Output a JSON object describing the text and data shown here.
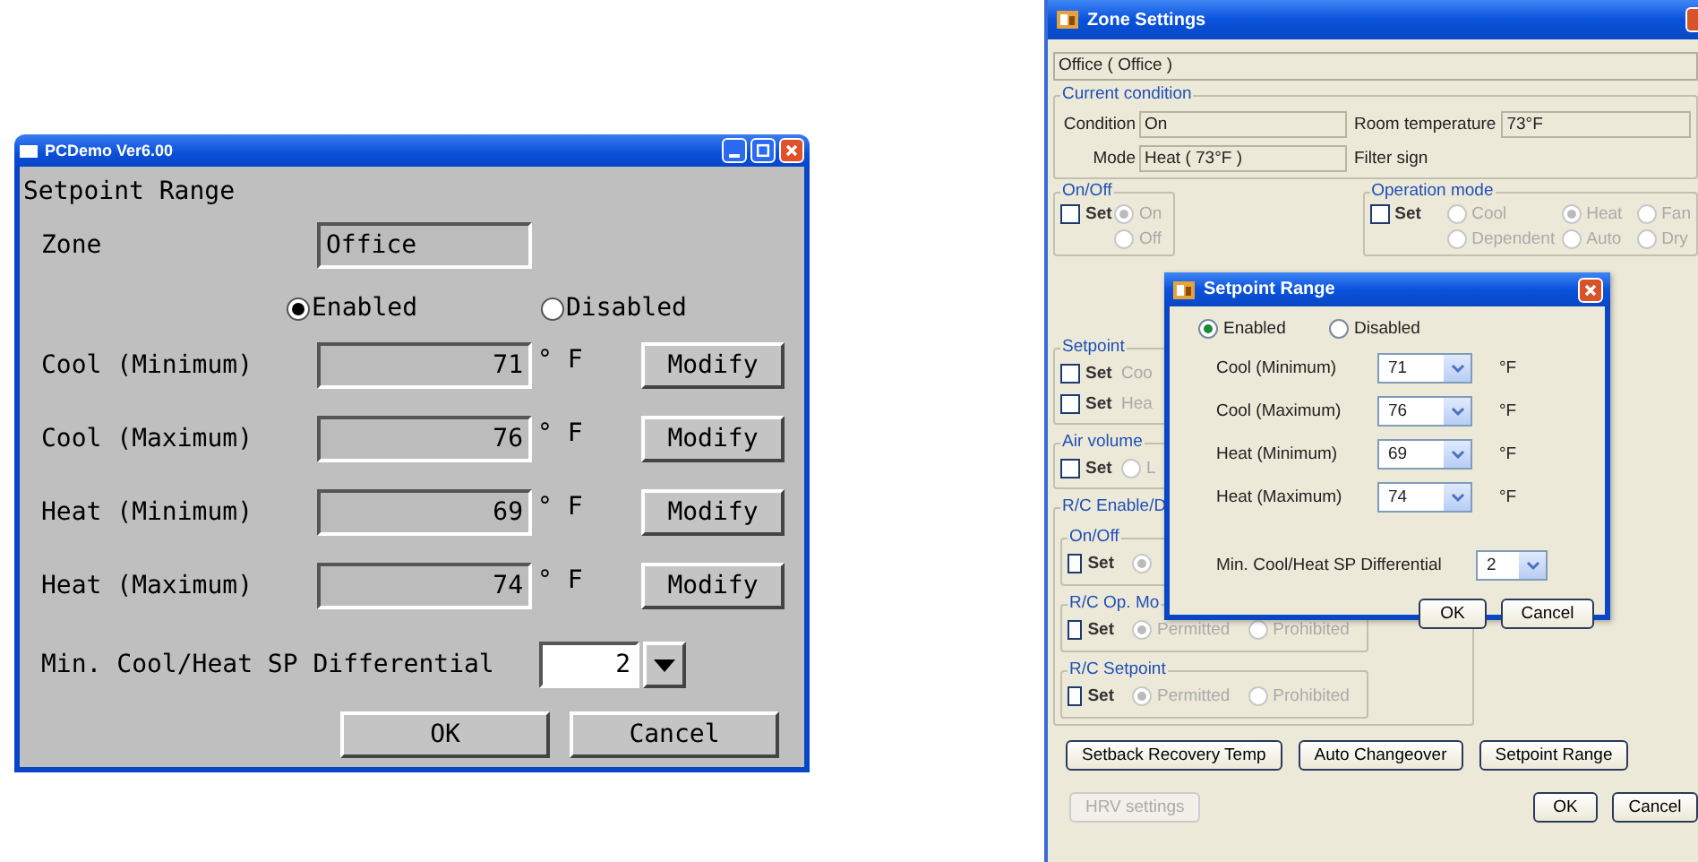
{
  "left_window": {
    "title": "PCDemo Ver6.00",
    "heading": "Setpoint Range",
    "zone": {
      "label": "Zone",
      "value": "Office"
    },
    "mode_options": [
      {
        "label": "Enabled",
        "selected": true
      },
      {
        "label": "Disabled",
        "selected": false
      }
    ],
    "rows": [
      {
        "label": "Cool (Minimum)",
        "value": "71",
        "unit": "° F",
        "button": "Modify"
      },
      {
        "label": "Cool (Maximum)",
        "value": "76",
        "unit": "° F",
        "button": "Modify"
      },
      {
        "label": "Heat (Minimum)",
        "value": "69",
        "unit": "° F",
        "button": "Modify"
      },
      {
        "label": "Heat (Maximum)",
        "value": "74",
        "unit": "° F",
        "button": "Modify"
      }
    ],
    "differential": {
      "label": "Min. Cool/Heat SP Differential",
      "value": "2"
    },
    "buttons": [
      "OK",
      "Cancel"
    ]
  },
  "zone_settings": {
    "title": "Zone Settings",
    "zone_name": "Office ( Office )",
    "current_condition": {
      "title": "Current condition",
      "fields": [
        {
          "label": "Condition",
          "value": "On"
        },
        {
          "label": "Room temperature",
          "value": "73°F"
        },
        {
          "label": "Mode",
          "value": "Heat ( 73°F )"
        },
        {
          "label": "Filter sign"
        }
      ]
    },
    "on_off": {
      "title": "On/Off",
      "set": {
        "label": "Set",
        "checked": false
      },
      "options": [
        {
          "label": "On",
          "selected": true,
          "disabled": true
        },
        {
          "label": "Off",
          "selected": false,
          "disabled": true
        }
      ]
    },
    "operation_mode": {
      "title": "Operation mode",
      "set": {
        "label": "Set",
        "checked": false
      },
      "options": [
        {
          "label": "Cool",
          "selected": false,
          "disabled": true
        },
        {
          "label": "Heat",
          "selected": true,
          "disabled": true
        },
        {
          "label": "Fan",
          "selected": false,
          "disabled": true
        },
        {
          "label": "Dependent",
          "selected": false,
          "disabled": true
        },
        {
          "label": "Auto",
          "selected": false,
          "disabled": true
        },
        {
          "label": "Dry",
          "selected": false,
          "disabled": true
        }
      ]
    },
    "setpoint": {
      "title": "Setpoint",
      "rows": [
        {
          "set": {
            "label": "Set",
            "checked": false
          },
          "label": "Coo"
        },
        {
          "set": {
            "label": "Set",
            "checked": false
          },
          "label": "Hea"
        }
      ]
    },
    "air_volume": {
      "title": "Air volume",
      "set": {
        "label": "Set",
        "checked": false
      },
      "options": [
        {
          "label": "L",
          "selected": false,
          "disabled": true
        }
      ]
    },
    "rc_enable": {
      "title": "R/C Enable/D",
      "groups": [
        {
          "title": "On/Off",
          "set": {
            "label": "Set",
            "checked": false
          },
          "options": [
            {
              "selected": true,
              "disabled": true
            }
          ]
        },
        {
          "title": "R/C Op. Mo",
          "set": {
            "label": "Set",
            "checked": false
          },
          "options": [
            {
              "label": "Permitted",
              "selected": true,
              "disabled": true
            },
            {
              "label": "Prohibited",
              "selected": false,
              "disabled": true
            }
          ]
        },
        {
          "title": "R/C Setpoint",
          "set": {
            "label": "Set",
            "checked": false
          },
          "options": [
            {
              "label": "Permitted",
              "selected": true,
              "disabled": true
            },
            {
              "label": "Prohibited",
              "selected": false,
              "disabled": true
            }
          ]
        }
      ]
    },
    "action_buttons": [
      "Setback Recovery Temp",
      "Auto Changeover",
      "Setpoint Range"
    ],
    "hrv_button": {
      "label": "HRV settings",
      "disabled": true
    },
    "buttons": [
      "OK",
      "Cancel"
    ]
  },
  "setpoint_dialog": {
    "title": "Setpoint Range",
    "mode_options": [
      {
        "label": "Enabled",
        "selected": true
      },
      {
        "label": "Disabled",
        "selected": false
      }
    ],
    "rows": [
      {
        "label": "Cool (Minimum)",
        "value": "71",
        "unit": "°F"
      },
      {
        "label": "Cool (Maximum)",
        "value": "76",
        "unit": "°F"
      },
      {
        "label": "Heat (Minimum)",
        "value": "69",
        "unit": "°F"
      },
      {
        "label": "Heat (Maximum)",
        "value": "74",
        "unit": "°F"
      }
    ],
    "differential": {
      "label": "Min. Cool/Heat SP Differential",
      "value": "2"
    },
    "buttons": [
      "OK",
      "Cancel"
    ]
  }
}
